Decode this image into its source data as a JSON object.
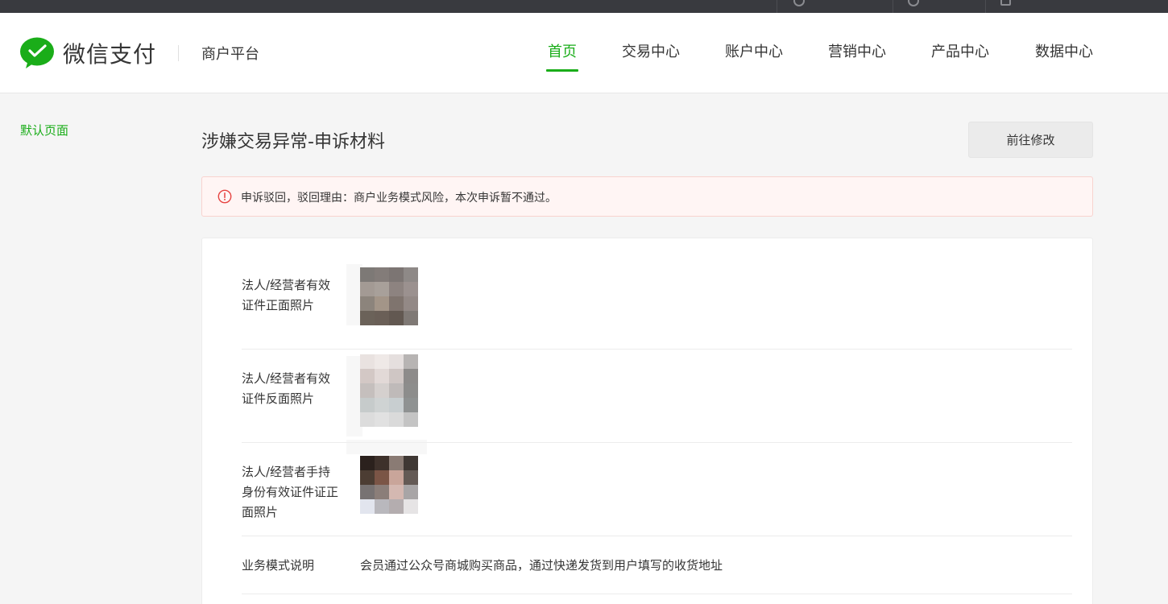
{
  "brand": {
    "name": "微信支付",
    "platform": "商户平台",
    "accent": "#1aad19"
  },
  "nav": {
    "items": [
      {
        "label": "首页",
        "active": true
      },
      {
        "label": "交易中心",
        "active": false
      },
      {
        "label": "账户中心",
        "active": false
      },
      {
        "label": "营销中心",
        "active": false
      },
      {
        "label": "产品中心",
        "active": false
      },
      {
        "label": "数据中心",
        "active": false
      }
    ]
  },
  "sidebar": {
    "default_page": "默认页面"
  },
  "main": {
    "title": "涉嫌交易异常-申诉材料",
    "edit_button": "前往修改",
    "alert": {
      "icon": "exclamation-circle-icon",
      "text": "申诉驳回，驳回理由：商户业务模式风险，本次申诉暂不通过。",
      "color": "#e64340"
    },
    "materials": [
      {
        "label": "法人/经营者有效证件正面照片",
        "type": "image"
      },
      {
        "label": "法人/经营者有效证件反面照片",
        "type": "image"
      },
      {
        "label": "法人/经营者手持身份有效证件证正面照片",
        "type": "image"
      },
      {
        "label": "业务模式说明",
        "type": "text",
        "value": "会员通过公众号商城购买商品，通过快递发货到用户填写的收货地址"
      }
    ]
  }
}
